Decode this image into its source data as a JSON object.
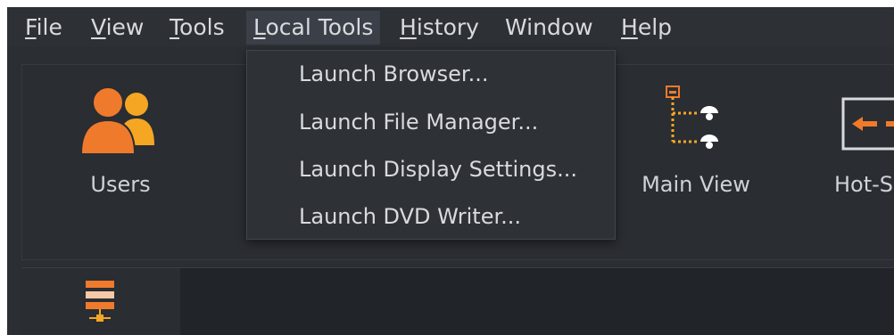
{
  "menubar": {
    "items": [
      {
        "label": "File",
        "underline": "F",
        "rest": "ile"
      },
      {
        "label": "View",
        "underline": "V",
        "rest": "iew"
      },
      {
        "label": "Tools",
        "underline": "T",
        "rest": "ools"
      },
      {
        "label": "Local Tools",
        "underline": "L",
        "rest": "ocal Tools"
      },
      {
        "label": "History",
        "underline": "H",
        "rest": "istory"
      },
      {
        "label": "Window",
        "underline": "",
        "rest": "Window"
      },
      {
        "label": "Help",
        "underline": "H",
        "rest": "elp"
      }
    ],
    "active": "Local Tools"
  },
  "dropdown": {
    "items": [
      "Launch Browser...",
      "Launch File Manager...",
      "Launch Display Settings...",
      "Launch DVD Writer..."
    ]
  },
  "toolbar": {
    "users_label": "Users",
    "main_view_label": "Main View",
    "hotspot_label": "Hot-Sp"
  },
  "colors": {
    "accent_orange": "#f07a2c",
    "accent_yellow": "#f5a623",
    "background": "#2b2e33"
  }
}
